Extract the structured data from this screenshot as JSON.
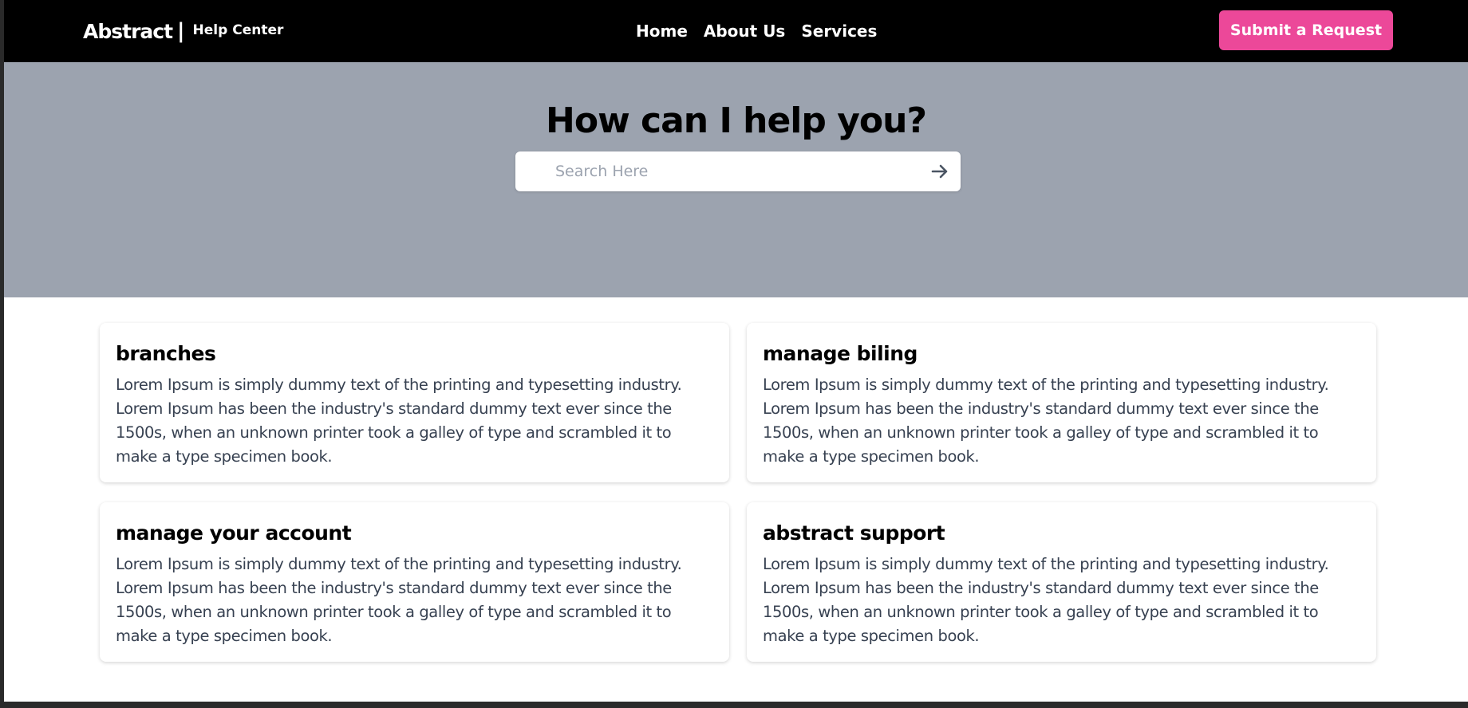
{
  "header": {
    "brand_name": "Abstract",
    "brand_separator": "|",
    "brand_sub": "Help Center",
    "nav": [
      "Home",
      "About Us",
      "Services"
    ],
    "submit_label": "Submit a Request"
  },
  "hero": {
    "title": "How can I help you?",
    "search_placeholder": "Search Here"
  },
  "cards": [
    {
      "title": "branches",
      "body": "Lorem Ipsum is simply dummy text of the printing and typesetting industry. Lorem Ipsum has been the industry's standard dummy text ever since the 1500s, when an unknown printer took a galley of type and scrambled it to make a type specimen book."
    },
    {
      "title": "manage biling",
      "body": "Lorem Ipsum is simply dummy text of the printing and typesetting industry. Lorem Ipsum has been the industry's standard dummy text ever since the 1500s, when an unknown printer took a galley of type and scrambled it to make a type specimen book."
    },
    {
      "title": "manage your account",
      "body": "Lorem Ipsum is simply dummy text of the printing and typesetting industry. Lorem Ipsum has been the industry's standard dummy text ever since the 1500s, when an unknown printer took a galley of type and scrambled it to make a type specimen book."
    },
    {
      "title": "abstract support",
      "body": "Lorem Ipsum is simply dummy text of the printing and typesetting industry. Lorem Ipsum has been the industry's standard dummy text ever since the 1500s, when an unknown printer took a galley of type and scrambled it to make a type specimen book."
    }
  ],
  "colors": {
    "nav_background": "#000000",
    "accent": "#ec4899",
    "hero_background": "#9ca3af"
  },
  "icons": {
    "search_submit": "arrow-right-icon"
  }
}
